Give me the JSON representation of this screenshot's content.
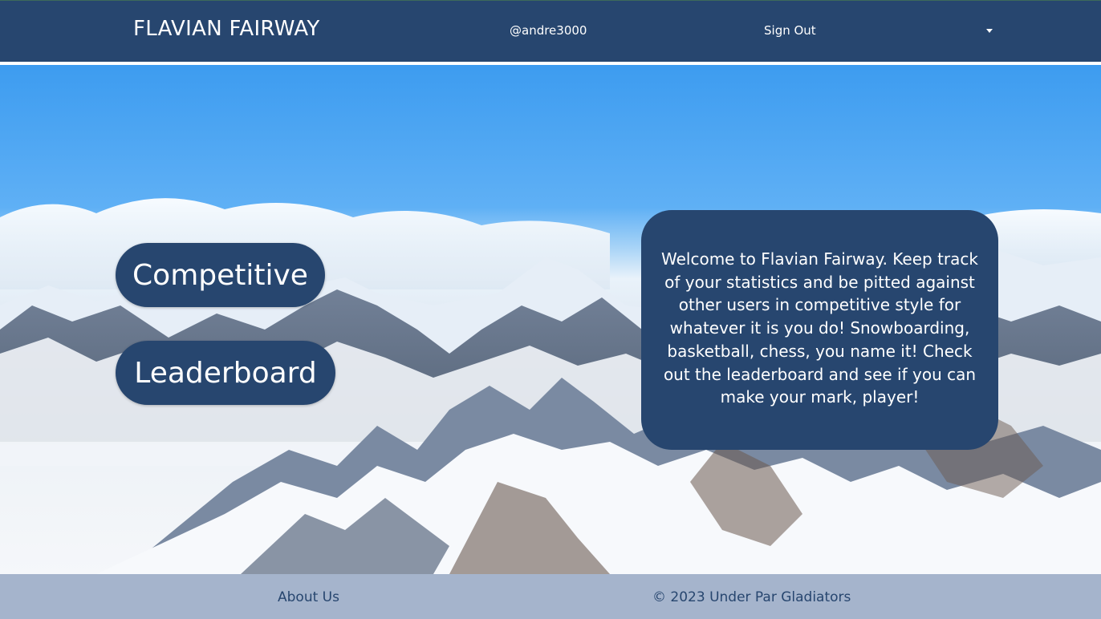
{
  "header": {
    "brand": "FLAVIAN FAIRWAY",
    "username": "@andre3000",
    "sign_out": "Sign Out",
    "dropdown_icon": "caret-down-icon"
  },
  "main": {
    "competitive_button": "Competitive",
    "leaderboard_button": "Leaderboard",
    "welcome_text": "Welcome to Flavian Fairway. Keep track of your statistics and be pitted against other users in competitive style for whatever it is you do! Snowboarding, basketball, chess, you name it! Check out the leaderboard and see if you can make your mark, player!"
  },
  "footer": {
    "about": "About Us",
    "copyright": "© 2023 Under Par Gladiators"
  },
  "colors": {
    "primary": "#27466f",
    "footer_bg": "#a5b4cc",
    "text_light": "#ffffff"
  }
}
